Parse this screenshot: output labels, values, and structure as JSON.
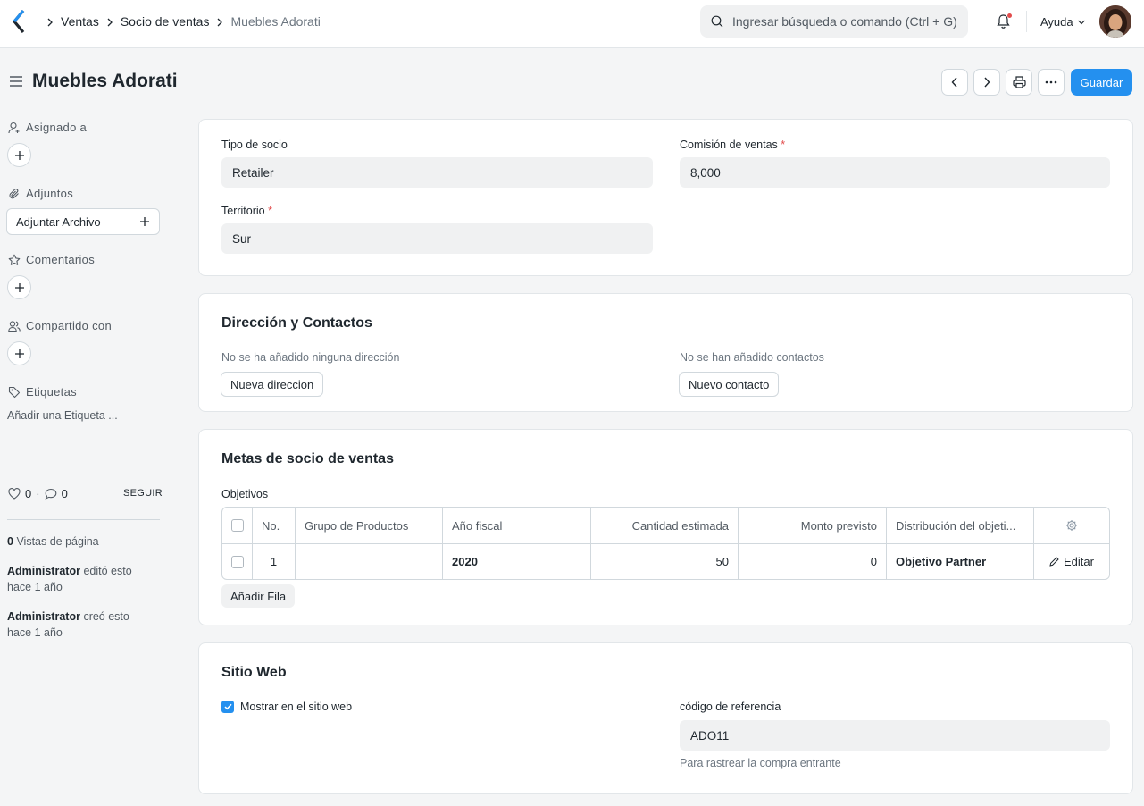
{
  "navbar": {
    "breadcrumbs": [
      "Ventas",
      "Socio de ventas",
      "Muebles Adorati"
    ],
    "search_placeholder": "Ingresar búsqueda o comando (Ctrl + G)",
    "help_label": "Ayuda"
  },
  "page": {
    "title": "Muebles Adorati",
    "save_label": "Guardar"
  },
  "sidebar": {
    "assigned_label": "Asignado a",
    "attachments_label": "Adjuntos",
    "attach_button": "Adjuntar Archivo",
    "comments_label": "Comentarios",
    "shared_label": "Compartido con",
    "tags_label": "Etiquetas",
    "add_tag": "Añadir una Etiqueta ...",
    "likes_count": "0",
    "comments_count": "0",
    "follow_label": "SEGUIR",
    "page_views_count": "0",
    "page_views_label": "Vistas de página",
    "activity": [
      {
        "user": "Administrator",
        "text": "editó esto",
        "time": "hace 1 año"
      },
      {
        "user": "Administrator",
        "text": "creó esto",
        "time": "hace 1 año"
      }
    ]
  },
  "details": {
    "partner_type_label": "Tipo de socio",
    "partner_type_value": "Retailer",
    "commission_label": "Comisión de ventas",
    "commission_value": "8,000",
    "territory_label": "Territorio",
    "territory_value": "Sur",
    "required_mark": "*"
  },
  "address": {
    "title": "Dirección y Contactos",
    "no_address": "No se ha añadido ninguna dirección",
    "new_address_button": "Nueva direccion",
    "no_contacts": "No se han añadido contactos",
    "new_contact_button": "Nuevo contacto"
  },
  "targets": {
    "title": "Metas de socio de ventas",
    "table_label": "Objetivos",
    "columns": [
      "No.",
      "Grupo de Productos",
      "Año fiscal",
      "Cantidad estimada",
      "Monto previsto",
      "Distribución del objeti..."
    ],
    "rows": [
      {
        "no": "1",
        "item_group": "",
        "fiscal_year": "2020",
        "target_qty": "50",
        "target_amount": "0",
        "distribution": "Objetivo Partner",
        "edit_label": "Editar"
      }
    ],
    "add_row_button": "Añadir Fila"
  },
  "website": {
    "title": "Sitio Web",
    "show_in_website_label": "Mostrar en el sitio web",
    "show_in_website_checked": true,
    "referral_code_label": "código de referencia",
    "referral_code_value": "ADO11",
    "referral_code_help": "Para rastrear la compra entrante"
  },
  "colors": {
    "primary": "#2490ef",
    "required": "#e24c4c"
  }
}
